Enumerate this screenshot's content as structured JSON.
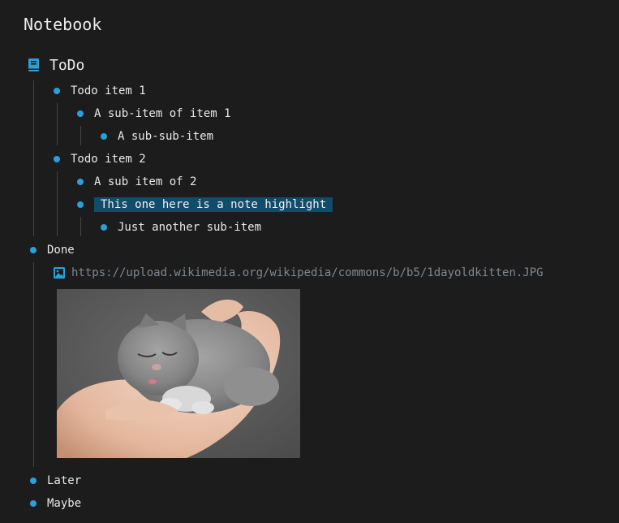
{
  "notebook": {
    "title": "Notebook"
  },
  "page": {
    "title": "ToDo",
    "icon": "book-icon"
  },
  "items": {
    "todo1": "Todo item 1",
    "sub1": "A sub-item of item 1",
    "subsub1": "A sub-sub-item",
    "todo2": "Todo item 2",
    "sub2a": "A sub item of 2",
    "sub2b": "This one here is a note highlight",
    "sub2c": "Just another sub-item",
    "done": "Done",
    "later": "Later",
    "maybe": "Maybe"
  },
  "attachment": {
    "icon": "image-icon",
    "url": "https://upload.wikimedia.org/wikipedia/commons/b/b5/1dayoldkitten.JPG",
    "image_subject": "kitten"
  },
  "colors": {
    "background": "#1c1c1c",
    "bullet": "#2c9fd9",
    "highlight": "#114d6b",
    "guide_line": "#444444",
    "link": "#7e8791"
  }
}
